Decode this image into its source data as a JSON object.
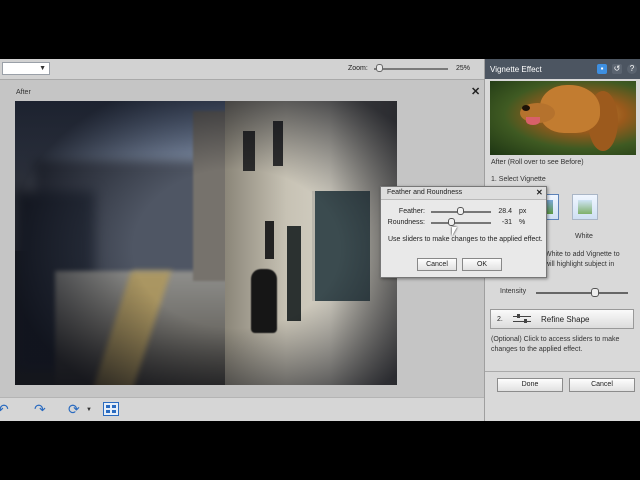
{
  "toolbar": {
    "zoom_label": "Zoom:",
    "zoom_value": "25%",
    "zoom_level": 0.25
  },
  "canvas": {
    "view_label": "After",
    "close_icon": "close-icon"
  },
  "bottom_toolbar": {
    "icons": [
      "undo-icon",
      "redo-icon",
      "rotate-icon",
      "grid-icon"
    ]
  },
  "panel": {
    "title": "Vignette Effect",
    "header_icons": [
      "image-icon",
      "refresh-icon",
      "help-icon"
    ],
    "preview_caption": "After (Roll over to see Before)",
    "step1_label": "1. Select Vignette",
    "style_white_label": "White",
    "style_text_line1": "White to add Vignette to",
    "style_text_line2": "will highlight subject in",
    "intensity_label": "Intensity",
    "intensity_level": 0.65,
    "refine_number": "2.",
    "refine_label": "Refine Shape",
    "help_text": "(Optional) Click to access sliders to make changes to the applied effect.",
    "done_label": "Done",
    "cancel_label": "Cancel"
  },
  "dialog": {
    "title": "Feather and Roundness",
    "feather_label": "Feather:",
    "feather_value": "28.4",
    "feather_unit": "px",
    "feather_level": 0.5,
    "roundness_label": "Roundness:",
    "roundness_value": "-31",
    "roundness_unit": "%",
    "roundness_level": 0.35,
    "help": "Use sliders to make changes to the applied effect.",
    "cancel_label": "Cancel",
    "ok_label": "OK"
  },
  "colors": {
    "panel_header": "#4c5561",
    "accent": "#2a6bc0"
  }
}
